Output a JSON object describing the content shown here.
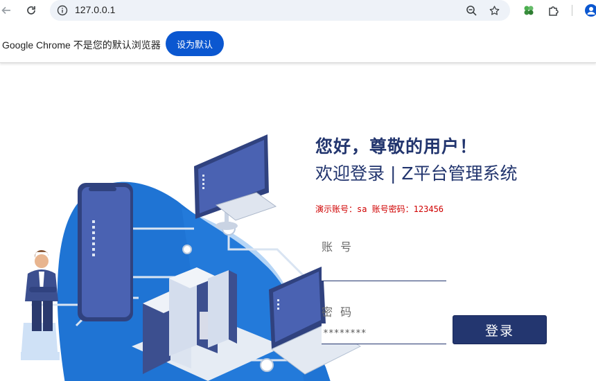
{
  "browser": {
    "url": "127.0.0.1",
    "icons": [
      "back-icon",
      "reload-icon",
      "site-info-icon",
      "zoom-icon",
      "bookmark-star-icon",
      "extension-clover-icon",
      "extensions-puzzle-icon",
      "profile-icon"
    ]
  },
  "infobar": {
    "message": "Google Chrome 不是您的默认浏览器",
    "set_default_button": "设为默认"
  },
  "login": {
    "greeting": "您好，尊敬的用户！",
    "welcome": "欢迎登录 | Z平台管理系统",
    "demo_hint": "演示账号：sa 账号密码：123456",
    "account_label": "账 号",
    "account_value": "",
    "password_label": "密 码",
    "password_value": "********",
    "submit_label": "登录"
  },
  "colors": {
    "brand_navy": "#23366f",
    "hint_red": "#d00000",
    "chrome_blue": "#0b57d0",
    "illustration_blue": "#1f74d4"
  }
}
